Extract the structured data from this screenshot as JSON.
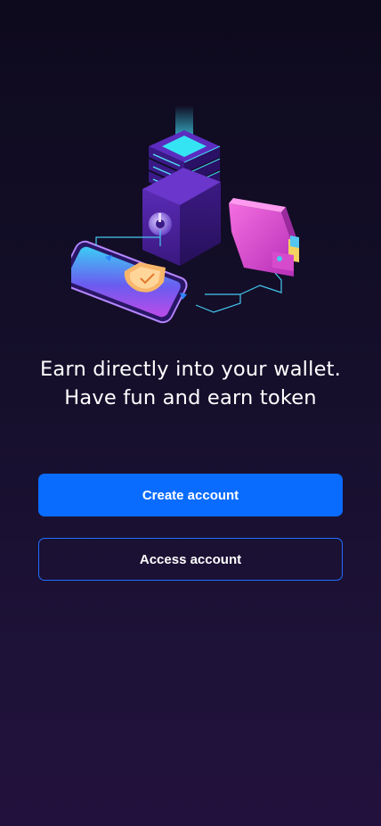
{
  "onboarding": {
    "headline_line1": "Earn directly into your wallet.",
    "headline_line2": "Have fun and earn token",
    "illustration": "secure-wallet-server-illustration"
  },
  "actions": {
    "create_label": "Create account",
    "access_label": "Access account"
  },
  "colors": {
    "background": "#130e27",
    "primary": "#0a6cff",
    "outline": "#1f6fff",
    "accent_cyan": "#3fd8f0",
    "accent_purple": "#7b3fe0",
    "accent_pink": "#e24fd0",
    "shield": "#f7b66a"
  }
}
